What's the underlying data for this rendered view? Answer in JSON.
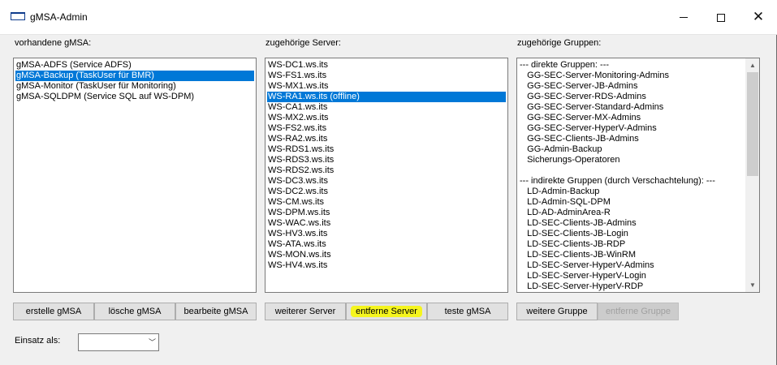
{
  "window": {
    "title": "gMSA-Admin",
    "icons": [
      "app-icon",
      "minimize-icon",
      "maximize-icon",
      "close-icon"
    ]
  },
  "labels": {
    "gmsa": "vorhandene gMSA:",
    "server": "zugehörige Server:",
    "groups": "zugehörige Gruppen:"
  },
  "gmsa_list": [
    "gMSA-ADFS (Service ADFS)",
    "gMSA-Backup (TaskUser für BMR)",
    "gMSA-Monitor (TaskUser für Monitoring)",
    "gMSA-SQLDPM (Service SQL auf WS-DPM)"
  ],
  "server_list": [
    "WS-DC1.ws.its",
    "WS-FS1.ws.its",
    "WS-MX1.ws.its",
    "WS-RA1.ws.its (offline)",
    "WS-CA1.ws.its",
    "WS-MX2.ws.its",
    "WS-FS2.ws.its",
    "WS-RA2.ws.its",
    "WS-RDS1.ws.its",
    "WS-RDS3.ws.its",
    "WS-RDS2.ws.its",
    "WS-DC3.ws.its",
    "WS-DC2.ws.its",
    "WS-CM.ws.its",
    "WS-DPM.ws.its",
    "WS-WAC.ws.its",
    "WS-HV3.ws.its",
    "WS-ATA.ws.its",
    "WS-MON.ws.its",
    "WS-HV4.ws.its"
  ],
  "groups_list": [
    "--- direkte Gruppen: ---",
    "   GG-SEC-Server-Monitoring-Admins",
    "   GG-SEC-Server-JB-Admins",
    "   GG-SEC-Server-RDS-Admins",
    "   GG-SEC-Server-Standard-Admins",
    "   GG-SEC-Server-MX-Admins",
    "   GG-SEC-Server-HyperV-Admins",
    "   GG-SEC-Clients-JB-Admins",
    "   GG-Admin-Backup",
    "   Sicherungs-Operatoren",
    "",
    "--- indirekte Gruppen (durch Verschachtelung): ---",
    "   LD-Admin-Backup",
    "   LD-Admin-SQL-DPM",
    "   LD-AD-AdminArea-R",
    "   LD-SEC-Clients-JB-Admins",
    "   LD-SEC-Clients-JB-Login",
    "   LD-SEC-Clients-JB-RDP",
    "   LD-SEC-Clients-JB-WinRM",
    "   LD-SEC-Server-HyperV-Admins",
    "   LD-SEC-Server-HyperV-Login",
    "   LD-SEC-Server-HyperV-RDP"
  ],
  "buttons": {
    "create": "erstelle gMSA",
    "delete": "lösche gMSA",
    "edit": "bearbeite gMSA",
    "add_server": "weiterer Server",
    "remove_server": "entferne Server",
    "test": "teste gMSA",
    "add_group": "weitere Gruppe",
    "remove_group": "entferne Gruppe"
  },
  "einsatz": {
    "label": "Einsatz als:",
    "value": ""
  },
  "colors": {
    "selection": "#0078d7",
    "highlight": "#f5f51e"
  }
}
